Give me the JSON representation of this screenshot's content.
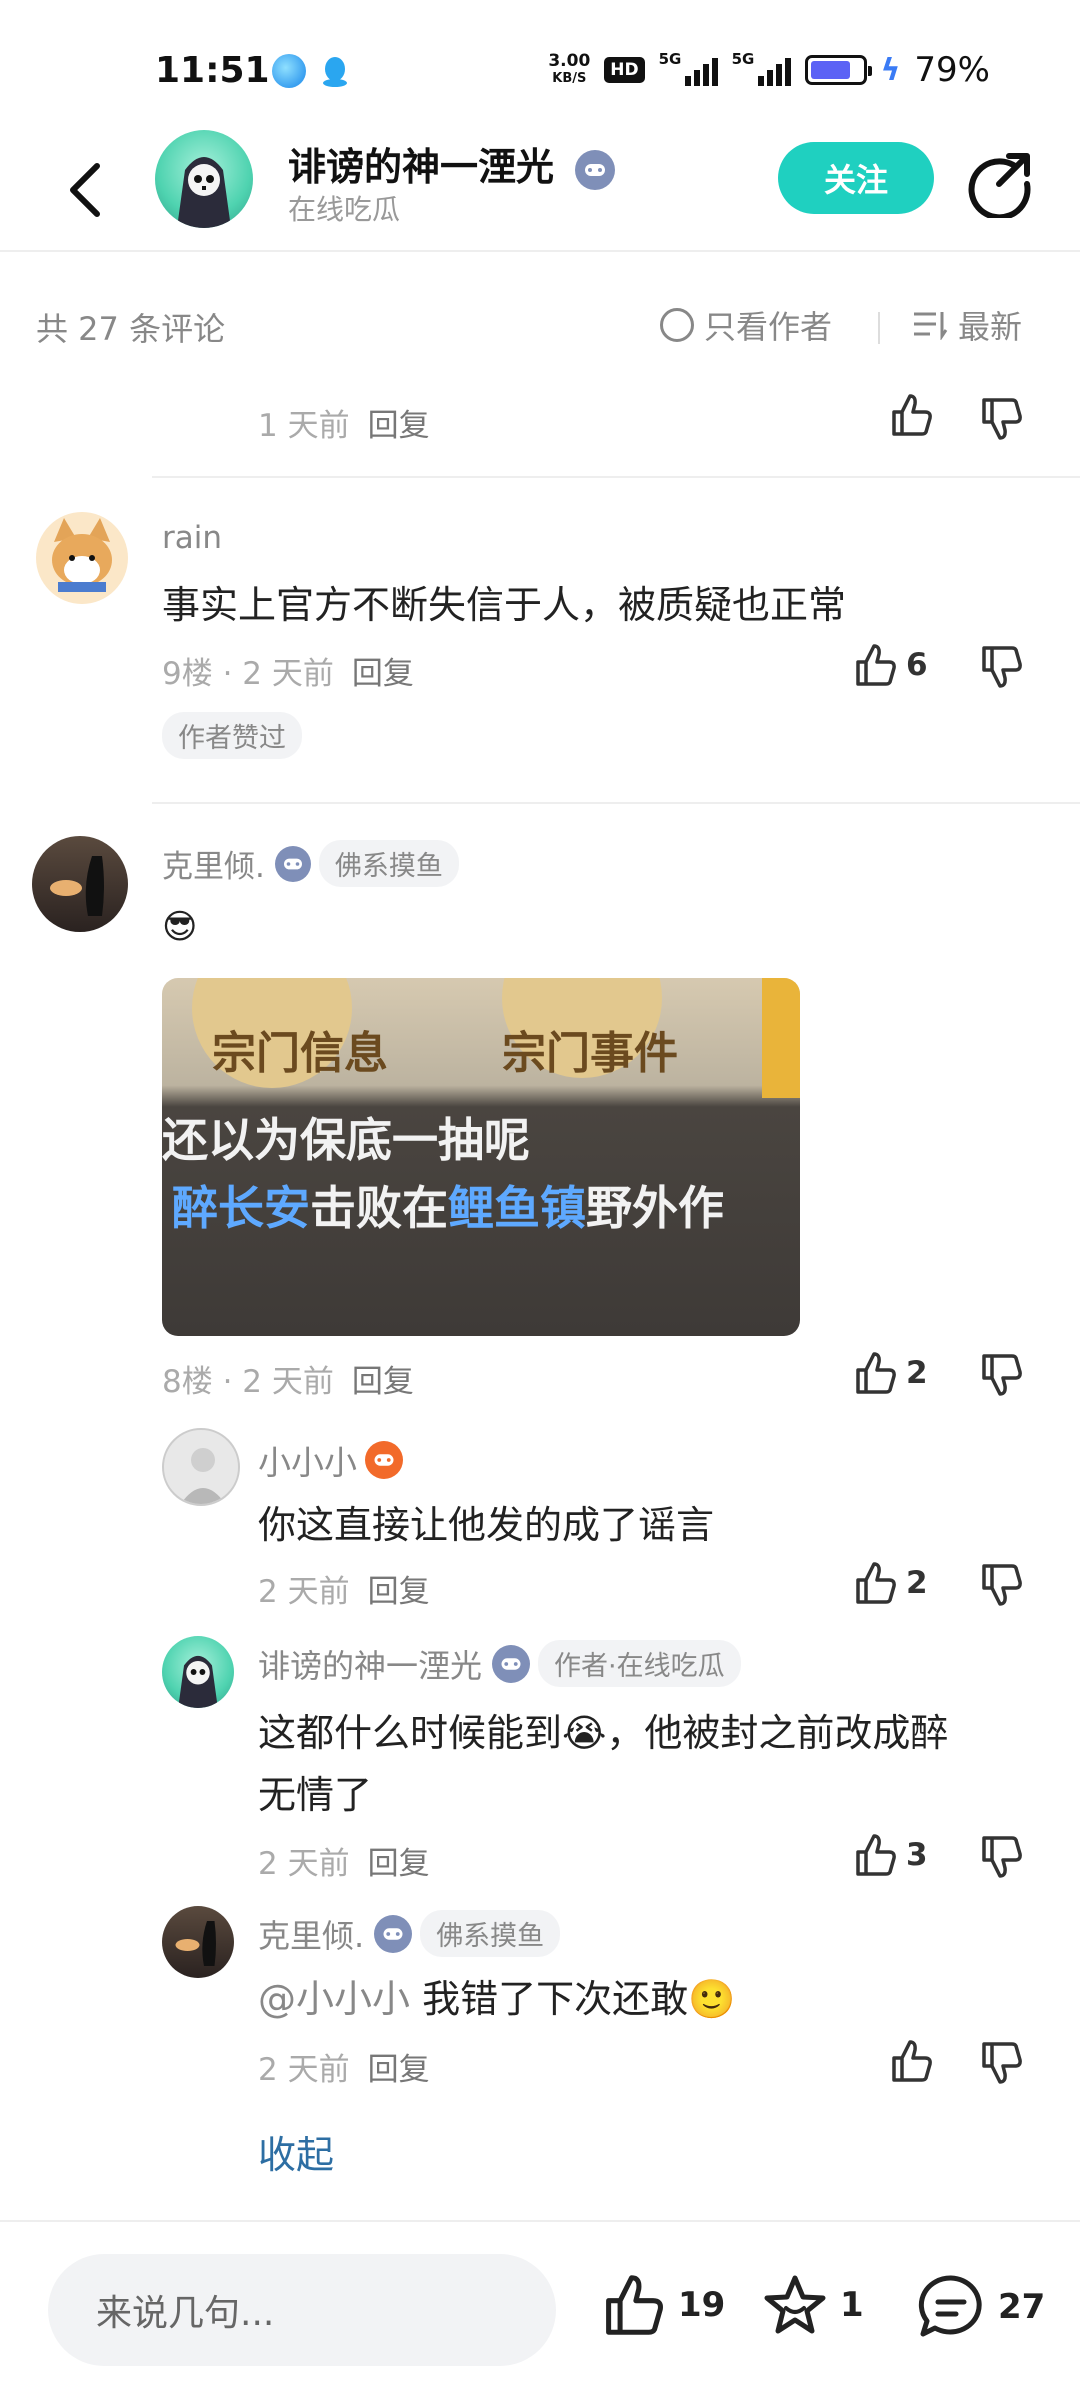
{
  "status_bar": {
    "time": "11:51",
    "net_speed_value": "3.00",
    "net_speed_unit": "KB/S",
    "hd_label": "HD",
    "sim1_label": "5G",
    "sim2_label": "5G",
    "battery_percent": "79%",
    "battery_level": 0.79
  },
  "header": {
    "title": "诽谤的神一湮光",
    "subtitle": "在线吃瓜",
    "follow_label": "关注"
  },
  "summary": {
    "count_label": "共 27 条评论",
    "only_author_label": "只看作者",
    "sort_label": "最新"
  },
  "comments": {
    "prev": {
      "time": "1 天前",
      "reply": "回复"
    },
    "c9": {
      "name": "rain",
      "text": "事实上官方不断失信于人，被质疑也正常",
      "floor_time": "9楼 · 2 天前",
      "reply": "回复",
      "likes": "6",
      "tag": "作者赞过"
    },
    "c8": {
      "name": "克里倾.",
      "badge": "佛系摸鱼",
      "emoji": "😎",
      "image_text_top_left": "宗门信息",
      "image_text_top_right": "宗门事件",
      "image_line1": "还以为保底一抽呢",
      "image_line2_a": "醉长安",
      "image_line2_b": "击败在",
      "image_line2_c": "鲤鱼镇",
      "image_line2_d": "野外作",
      "floor_time": "8楼 · 2 天前",
      "reply": "回复",
      "likes": "2"
    },
    "r1": {
      "name": "小小小",
      "text": "你这直接让他发的成了谣言",
      "time": "2 天前",
      "reply": "回复",
      "likes": "2"
    },
    "r2": {
      "name": "诽谤的神一湮光",
      "badge": "作者·在线吃瓜",
      "text_line1": "这都什么时候能到😭，他被封之前改成醉",
      "text_line2": "无情了",
      "time": "2 天前",
      "reply": "回复",
      "likes": "3"
    },
    "r3": {
      "name": "克里倾.",
      "badge": "佛系摸鱼",
      "mention": "@小小小",
      "text": " 我错了下次还敢🙂",
      "time": "2 天前",
      "reply": "回复"
    },
    "collapse_label": "收起"
  },
  "bottom_bar": {
    "input_placeholder": "来说几句...",
    "likes": "19",
    "favorites": "1",
    "comments": "27"
  },
  "colors": {
    "accent": "#1fd0c0",
    "link": "#2d6ea3",
    "battery": "#5b62f5"
  }
}
